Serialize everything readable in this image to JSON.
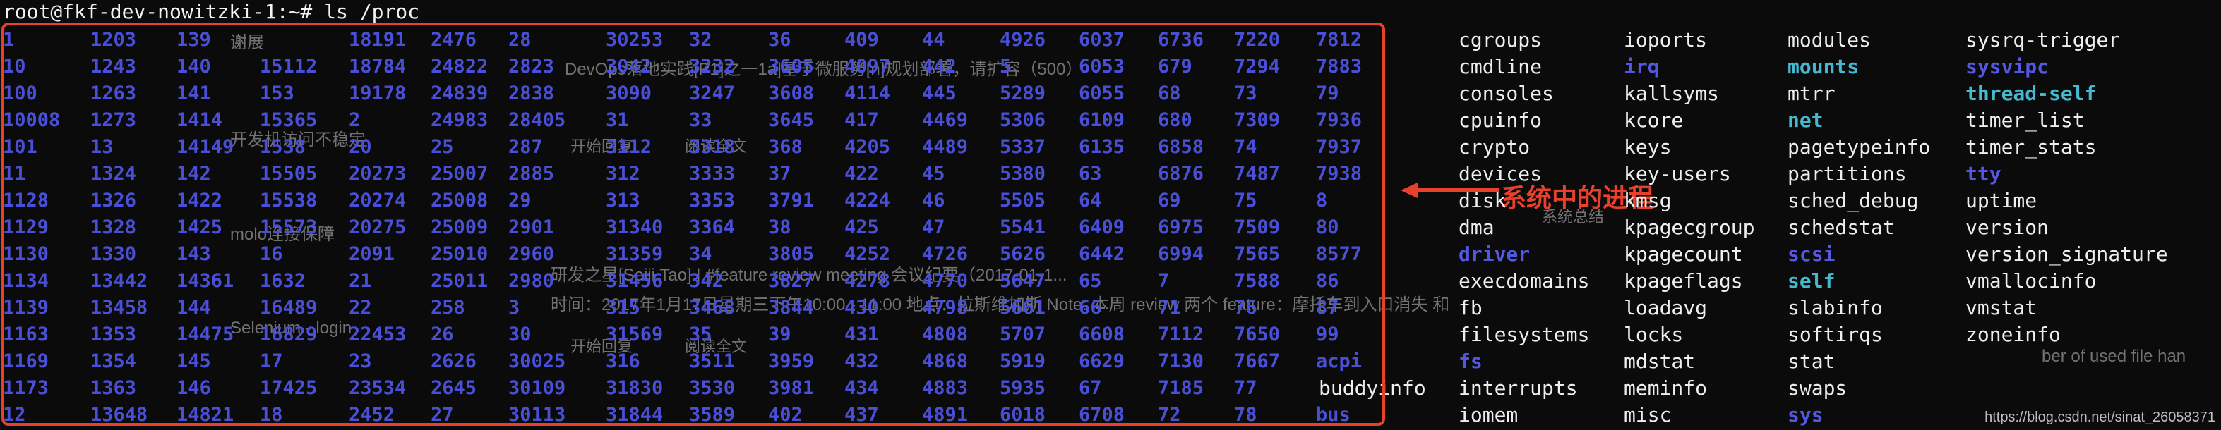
{
  "terminal": {
    "prompt": "root@fkf-dev-nowitzki-1:~# ls /proc",
    "pid_rows": [
      [
        "1",
        "1203",
        "139",
        "",
        "18191",
        "2476",
        "28",
        "30253",
        "32",
        "36",
        "409",
        "44",
        "4926",
        "6037",
        "6736",
        "7220",
        "7812"
      ],
      [
        "10",
        "1243",
        "140",
        "15112",
        "18784",
        "24822",
        "2823",
        "3042",
        "3232",
        "3605",
        "4097",
        "442",
        "5",
        "6053",
        "679",
        "7294",
        "7883"
      ],
      [
        "100",
        "1263",
        "141",
        "153",
        "19178",
        "24839",
        "2838",
        "3090",
        "3247",
        "3608",
        "4114",
        "445",
        "5289",
        "6055",
        "68",
        "73",
        "79"
      ],
      [
        "10008",
        "1273",
        "1414",
        "15365",
        "2",
        "24983",
        "28405",
        "31",
        "33",
        "3645",
        "417",
        "4469",
        "5306",
        "6109",
        "680",
        "7309",
        "7936"
      ],
      [
        "101",
        "13",
        "14149",
        "1538",
        "20",
        "25",
        "287",
        "3112",
        "3318",
        "368",
        "4205",
        "4489",
        "5337",
        "6135",
        "6858",
        "74",
        "7937"
      ],
      [
        "11",
        "1324",
        "142",
        "15505",
        "20273",
        "25007",
        "2885",
        "312",
        "3333",
        "37",
        "422",
        "45",
        "5380",
        "63",
        "6876",
        "7487",
        "7938"
      ],
      [
        "1128",
        "1326",
        "1422",
        "15538",
        "20274",
        "25008",
        "29",
        "313",
        "3353",
        "3791",
        "4224",
        "46",
        "5505",
        "64",
        "69",
        "75",
        "8"
      ],
      [
        "1129",
        "1328",
        "1425",
        "15573",
        "20275",
        "25009",
        "2901",
        "31340",
        "3364",
        "38",
        "425",
        "47",
        "5541",
        "6409",
        "6975",
        "7509",
        "80"
      ],
      [
        "1130",
        "1330",
        "143",
        "16",
        "2091",
        "25010",
        "2960",
        "31359",
        "34",
        "3805",
        "4252",
        "4726",
        "5626",
        "6442",
        "6994",
        "7565",
        "8577"
      ],
      [
        "1134",
        "13442",
        "14361",
        "1632",
        "21",
        "25011",
        "2980",
        "31456",
        "342",
        "3827",
        "4278",
        "4770",
        "5647",
        "65",
        "7",
        "7588",
        "86"
      ],
      [
        "1139",
        "13458",
        "144",
        "16489",
        "22",
        "258",
        "3",
        "315",
        "3468",
        "3844",
        "430",
        "4798",
        "5661",
        "66",
        "71",
        "76",
        "87"
      ],
      [
        "1163",
        "1353",
        "14475",
        "16829",
        "22453",
        "26",
        "30",
        "31569",
        "35",
        "39",
        "431",
        "4808",
        "5707",
        "6608",
        "7112",
        "7650",
        "99"
      ],
      [
        "1169",
        "1354",
        "145",
        "17",
        "23",
        "2626",
        "30025",
        "316",
        "3511",
        "3959",
        "432",
        "4868",
        "5919",
        "6629",
        "7130",
        "7667",
        "acpi"
      ],
      [
        "1173",
        "1363",
        "146",
        "17425",
        "23534",
        "2645",
        "30109",
        "31830",
        "3530",
        "3981",
        "434",
        "4883",
        "5935",
        "67",
        "7185",
        "77",
        ""
      ],
      [
        "12",
        "13648",
        "14821",
        "18",
        "2452",
        "27",
        "30113",
        "31844",
        "3589",
        "402",
        "437",
        "4891",
        "6018",
        "6708",
        "72",
        "78",
        "bus"
      ]
    ],
    "buddyinfo": "buddyinfo",
    "entry_columns": [
      [
        {
          "name": "cgroups",
          "kind": "file"
        },
        {
          "name": "cmdline",
          "kind": "file"
        },
        {
          "name": "consoles",
          "kind": "file"
        },
        {
          "name": "cpuinfo",
          "kind": "file"
        },
        {
          "name": "crypto",
          "kind": "file"
        },
        {
          "name": "devices",
          "kind": "file"
        },
        {
          "name": "disk",
          "kind": "file"
        },
        {
          "name": "dma",
          "kind": "file"
        },
        {
          "name": "driver",
          "kind": "dir"
        },
        {
          "name": "execdomains",
          "kind": "file"
        },
        {
          "name": "fb",
          "kind": "file"
        },
        {
          "name": "filesystems",
          "kind": "file"
        },
        {
          "name": "fs",
          "kind": "dir"
        },
        {
          "name": "interrupts",
          "kind": "file"
        },
        {
          "name": "iomem",
          "kind": "file"
        }
      ],
      [
        {
          "name": "ioports",
          "kind": "file"
        },
        {
          "name": "irq",
          "kind": "dir"
        },
        {
          "name": "kallsyms",
          "kind": "file"
        },
        {
          "name": "kcore",
          "kind": "file"
        },
        {
          "name": "keys",
          "kind": "file"
        },
        {
          "name": "key-users",
          "kind": "file"
        },
        {
          "name": "kmsg",
          "kind": "file"
        },
        {
          "name": "kpagecgroup",
          "kind": "file"
        },
        {
          "name": "kpagecount",
          "kind": "file"
        },
        {
          "name": "kpageflags",
          "kind": "file"
        },
        {
          "name": "loadavg",
          "kind": "file"
        },
        {
          "name": "locks",
          "kind": "file"
        },
        {
          "name": "mdstat",
          "kind": "file"
        },
        {
          "name": "meminfo",
          "kind": "file"
        },
        {
          "name": "misc",
          "kind": "file"
        }
      ],
      [
        {
          "name": "modules",
          "kind": "file"
        },
        {
          "name": "mounts",
          "kind": "link"
        },
        {
          "name": "mtrr",
          "kind": "file"
        },
        {
          "name": "net",
          "kind": "link"
        },
        {
          "name": "pagetypeinfo",
          "kind": "file"
        },
        {
          "name": "partitions",
          "kind": "file"
        },
        {
          "name": "sched_debug",
          "kind": "file"
        },
        {
          "name": "schedstat",
          "kind": "file"
        },
        {
          "name": "scsi",
          "kind": "dir"
        },
        {
          "name": "self",
          "kind": "link"
        },
        {
          "name": "slabinfo",
          "kind": "file"
        },
        {
          "name": "softirqs",
          "kind": "file"
        },
        {
          "name": "stat",
          "kind": "file"
        },
        {
          "name": "swaps",
          "kind": "file"
        },
        {
          "name": "sys",
          "kind": "dir"
        }
      ],
      [
        {
          "name": "sysrq-trigger",
          "kind": "file"
        },
        {
          "name": "sysvipc",
          "kind": "dir"
        },
        {
          "name": "thread-self",
          "kind": "link"
        },
        {
          "name": "timer_list",
          "kind": "file"
        },
        {
          "name": "timer_stats",
          "kind": "file"
        },
        {
          "name": "tty",
          "kind": "dir"
        },
        {
          "name": "uptime",
          "kind": "file"
        },
        {
          "name": "version",
          "kind": "file"
        },
        {
          "name": "version_signature",
          "kind": "file"
        },
        {
          "name": "vmallocinfo",
          "kind": "file"
        },
        {
          "name": "vmstat",
          "kind": "file"
        },
        {
          "name": "zoneinfo",
          "kind": "file"
        }
      ]
    ]
  },
  "annotation": {
    "label": "系统中的进程",
    "color": "#e8402a"
  },
  "background_ghost_text": [
    "谢展",
    "DevOps落地实践[P1]之一1a]基于微服务[n]规划部署，请扩容（500）",
    "开始回复",
    "阅读全文",
    "开发机访问不稳定",
    "molo连接保障",
    "系统总结",
    "研发之星[Seiji Tao] | #feature review meeting 会议纪要（2017-01-1...",
    "时间：2017年1月17日星期三下午10:00 - 11:00 地点：拉斯维加斯 Note: 本周 review 两个 feature：摩托车到入口消失 和",
    "开始回复",
    "阅读全文",
    "Selenium - login",
    "ber of used file han"
  ],
  "watermark": "https://blog.csdn.net/sinat_26058371",
  "colors": {
    "background": "#0b0b0b",
    "pid_blue": "#4a4fd8",
    "dir_blue": "#5458e0",
    "link_cyan": "#45b9d0",
    "file_white": "#eeeeee",
    "accent_red": "#e8402a"
  }
}
